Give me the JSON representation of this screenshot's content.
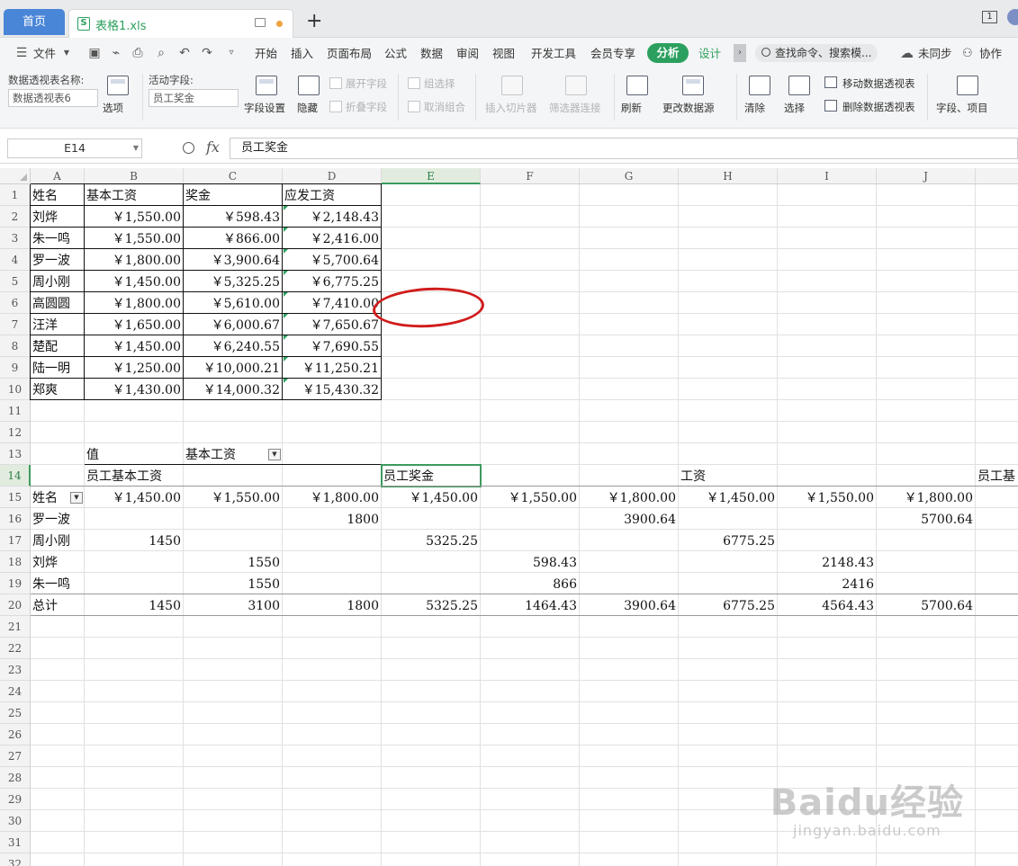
{
  "tabs": {
    "home": "首页",
    "file": "表格1.xls"
  },
  "window": {
    "count_badge": "1"
  },
  "menubar": {
    "file_menu": "文件",
    "items": [
      "开始",
      "插入",
      "页面布局",
      "公式",
      "数据",
      "审阅",
      "视图",
      "开发工具",
      "会员专享"
    ],
    "active_tab": "分析",
    "design_tab": "设计",
    "search_placeholder": "查找命令、搜索模...",
    "sync": "未同步",
    "collab": "协作"
  },
  "ribbon": {
    "pivot_name_label": "数据透视表名称:",
    "pivot_name_value": "数据透视表6",
    "options": "选项",
    "active_field_label": "活动字段:",
    "active_field_value": "员工奖金",
    "field_settings": "字段设置",
    "hide": "隐藏",
    "expand_field": "展开字段",
    "collapse_field": "折叠字段",
    "group_select": "组选择",
    "ungroup": "取消组合",
    "insert_slicer": "插入切片器",
    "filter_connection": "筛选器连接",
    "refresh": "刷新",
    "change_source": "更改数据源",
    "clear": "清除",
    "select": "选择",
    "move_pivot": "移动数据透视表",
    "delete_pivot": "删除数据透视表",
    "fields_items": "字段、项目"
  },
  "formula": {
    "cell_ref": "E14",
    "fx": "fx",
    "content": "员工奖金"
  },
  "grid": {
    "columns": [
      "A",
      "B",
      "C",
      "D",
      "E",
      "F",
      "G",
      "H",
      "I",
      "J"
    ],
    "rows": [
      "1",
      "2",
      "3",
      "4",
      "5",
      "6",
      "7",
      "8",
      "9",
      "10",
      "11",
      "12",
      "13",
      "14",
      "15",
      "16",
      "17",
      "18",
      "19",
      "20",
      "21",
      "22",
      "23",
      "24",
      "25",
      "26",
      "27",
      "28",
      "29",
      "30",
      "31",
      "32"
    ],
    "source_table": {
      "headers": [
        "姓名",
        "基本工资",
        "奖金",
        "应发工资"
      ],
      "rows": [
        [
          "刘烨",
          "￥1,550.00",
          "￥598.43",
          "￥2,148.43"
        ],
        [
          "朱一鸣",
          "￥1,550.00",
          "￥866.00",
          "￥2,416.00"
        ],
        [
          "罗一波",
          "￥1,800.00",
          "￥3,900.64",
          "￥5,700.64"
        ],
        [
          "周小刚",
          "￥1,450.00",
          "￥5,325.25",
          "￥6,775.25"
        ],
        [
          "高圆圆",
          "￥1,800.00",
          "￥5,610.00",
          "￥7,410.00"
        ],
        [
          "汪洋",
          "￥1,650.00",
          "￥6,000.67",
          "￥7,650.67"
        ],
        [
          "楚配",
          "￥1,450.00",
          "￥6,240.55",
          "￥7,690.55"
        ],
        [
          "陆一明",
          "￥1,250.00",
          "￥10,000.21",
          "￥11,250.21"
        ],
        [
          "郑爽",
          "￥1,430.00",
          "￥14,000.32",
          "￥15,430.32"
        ]
      ]
    },
    "pivot": {
      "value_label": "值",
      "column_field": "基本工资",
      "groups": [
        "员工基本工资",
        "员工奖金",
        "工资",
        "员工基"
      ],
      "row_field": "姓名",
      "col_values": [
        "￥1,450.00",
        "￥1,550.00",
        "￥1,800.00",
        "￥1,450.00",
        "￥1,550.00",
        "￥1,800.00",
        "￥1,450.00",
        "￥1,550.00",
        "￥1,800.00"
      ],
      "rows": [
        [
          "罗一波",
          "",
          "",
          "1800",
          "",
          "",
          "3900.64",
          "",
          "",
          "5700.64"
        ],
        [
          "周小刚",
          "1450",
          "",
          "",
          "5325.25",
          "",
          "",
          "6775.25",
          "",
          ""
        ],
        [
          "刘烨",
          "",
          "1550",
          "",
          "",
          "598.43",
          "",
          "",
          "2148.43",
          ""
        ],
        [
          "朱一鸣",
          "",
          "1550",
          "",
          "",
          "866",
          "",
          "",
          "2416",
          ""
        ],
        [
          "总计",
          "1450",
          "3100",
          "1800",
          "5325.25",
          "1464.43",
          "3900.64",
          "6775.25",
          "4564.43",
          "5700.64"
        ]
      ]
    }
  },
  "watermark": {
    "brand": "Baidu经验",
    "url": "jingyan.baidu.com"
  }
}
